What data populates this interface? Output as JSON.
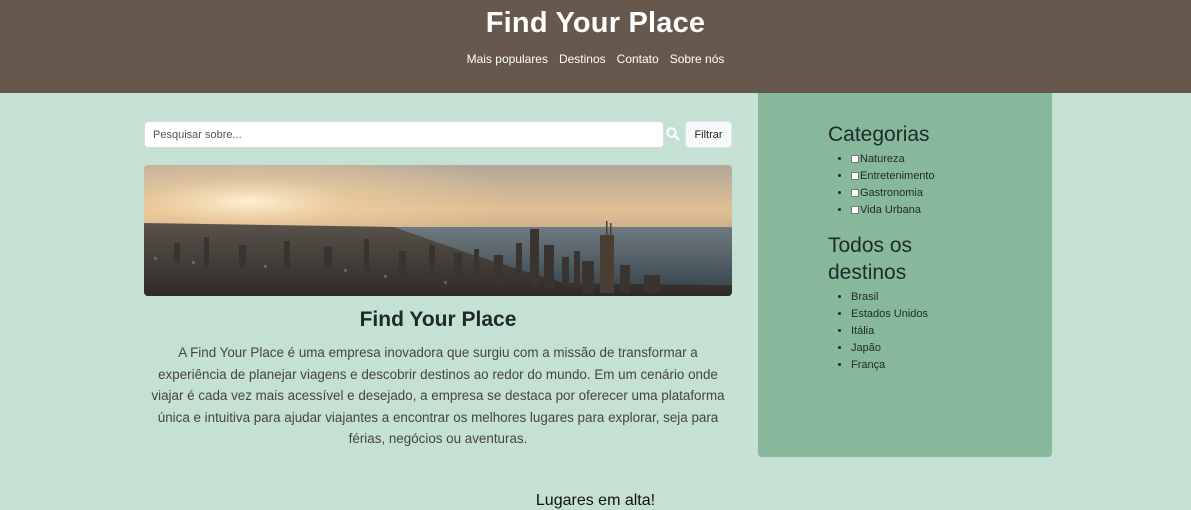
{
  "header": {
    "title": "Find Your Place",
    "nav": [
      "Mais populares",
      "Destinos",
      "Contato",
      "Sobre nós"
    ]
  },
  "search": {
    "placeholder": "Pesquisar sobre...",
    "value": "",
    "filter_label": "Filtrar",
    "icon": "search-icon"
  },
  "about": {
    "title": "Find Your Place",
    "text": "A Find Your Place é uma empresa inovadora que surgiu com a missão de transformar a experiência de planejar viagens e descobrir destinos ao redor do mundo. Em um cenário onde viajar é cada vez mais acessível e desejado, a empresa se destaca por oferecer uma plataforma única e intuitiva para ajudar viajantes a encontrar os melhores lugares para explorar, seja para férias, negócios ou aventuras."
  },
  "sidebar": {
    "categories_title": "Categorias",
    "categories": [
      "Natureza",
      "Entretenimento",
      "Gastronomia",
      "Vida Urbana"
    ],
    "destinations_title": "Todos os destinos",
    "destinations": [
      "Brasil",
      "Estados Unidos",
      "Itália",
      "Japão",
      "França"
    ]
  },
  "trending_title": "Lugares em alta!",
  "colors": {
    "header_bg": "#66584d",
    "page_bg": "#c5e1d4",
    "sidebar_bg": "#87b89b"
  }
}
